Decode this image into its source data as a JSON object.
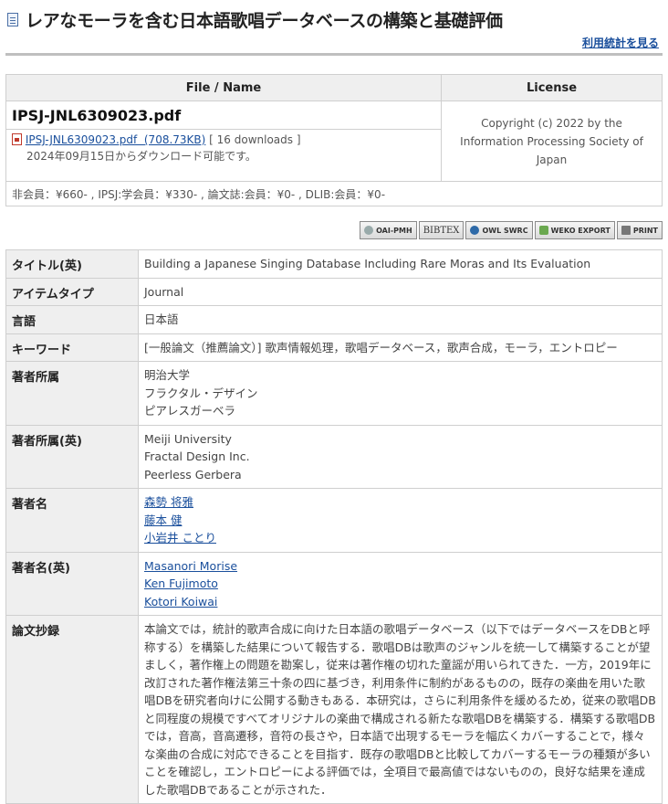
{
  "page": {
    "title": "レアなモーラを含む日本語歌唱データベースの構築と基礎評価",
    "stats_link": "利用統計を見る"
  },
  "file_table": {
    "header_file": "File / Name",
    "header_license": "License",
    "file_name": "IPSJ-JNL6309023.pdf",
    "download_link": "IPSJ-JNL6309023.pdf  (708.73KB)",
    "downloads": "[ 16 downloads ]",
    "available_from": "2024年09月15日からダウンロード可能です。",
    "license": "Copyright (c) 2022 by the Information Processing Society of Japan",
    "price": "非会員：¥660- , IPSJ:学会員：¥330- , 論文誌:会員：¥0- , DLIB:会員：¥0-"
  },
  "export_buttons": [
    "OAI-PMH",
    "BIBTEX",
    "OWL SWRC",
    "WEKO EXPORT",
    "PRINT"
  ],
  "metadata": {
    "title_en_label": "タイトル(英)",
    "title_en": "Building a Japanese Singing Database Including Rare Moras and Its Evaluation",
    "item_type_label": "アイテムタイプ",
    "item_type": "Journal",
    "language_label": "言語",
    "language": "日本語",
    "keywords_label": "キーワード",
    "keywords": "[一般論文（推薦論文）] 歌声情報処理，歌唱データベース，歌声合成，モーラ，エントロピー",
    "affiliation_label": "著者所属",
    "affiliations": [
      "明治大学",
      "フラクタル・デザイン",
      "ピアレスガーベラ"
    ],
    "affiliation_en_label": "著者所属(英)",
    "affiliations_en": [
      "Meiji University",
      "Fractal Design Inc.",
      "Peerless Gerbera"
    ],
    "authors_label": "著者名",
    "authors": [
      "森勢 将雅",
      "藤本 健",
      "小岩井 ことり"
    ],
    "authors_en_label": "著者名(英)",
    "authors_en": [
      "Masanori Morise",
      "Ken Fujimoto",
      "Kotori Koiwai"
    ],
    "abstract_label": "論文抄録",
    "abstract": "本論文では，統計的歌声合成に向けた日本語の歌唱データベース（以下ではデータベースをDBと呼称する）を構築した結果について報告する．歌唱DBは歌声のジャンルを統一して構築することが望ましく，著作権上の問題を勘案し，従来は著作権の切れた童謡が用いられてきた．一方，2019年に改訂された著作権法第三十条の四に基づき，利用条件に制約があるものの，既存の楽曲を用いた歌唱DBを研究者向けに公開する動きもある．本研究は，さらに利用条件を緩めるため，従来の歌唱DBと同程度の規模ですべてオリジナルの楽曲で構成される新たな歌唱DBを構築する．構築する歌唱DBでは，音高，音高遷移，音符の長さや，日本語で出現するモーラを幅広くカバーすることで，様々な楽曲の合成に対応できることを目指す．既存の歌唱DBと比較してカバーするモーラの種類が多いことを確認し，エントロピーによる評価では，全項目で最高値ではないものの，良好な結果を達成した歌唱DBであることが示された．"
  }
}
